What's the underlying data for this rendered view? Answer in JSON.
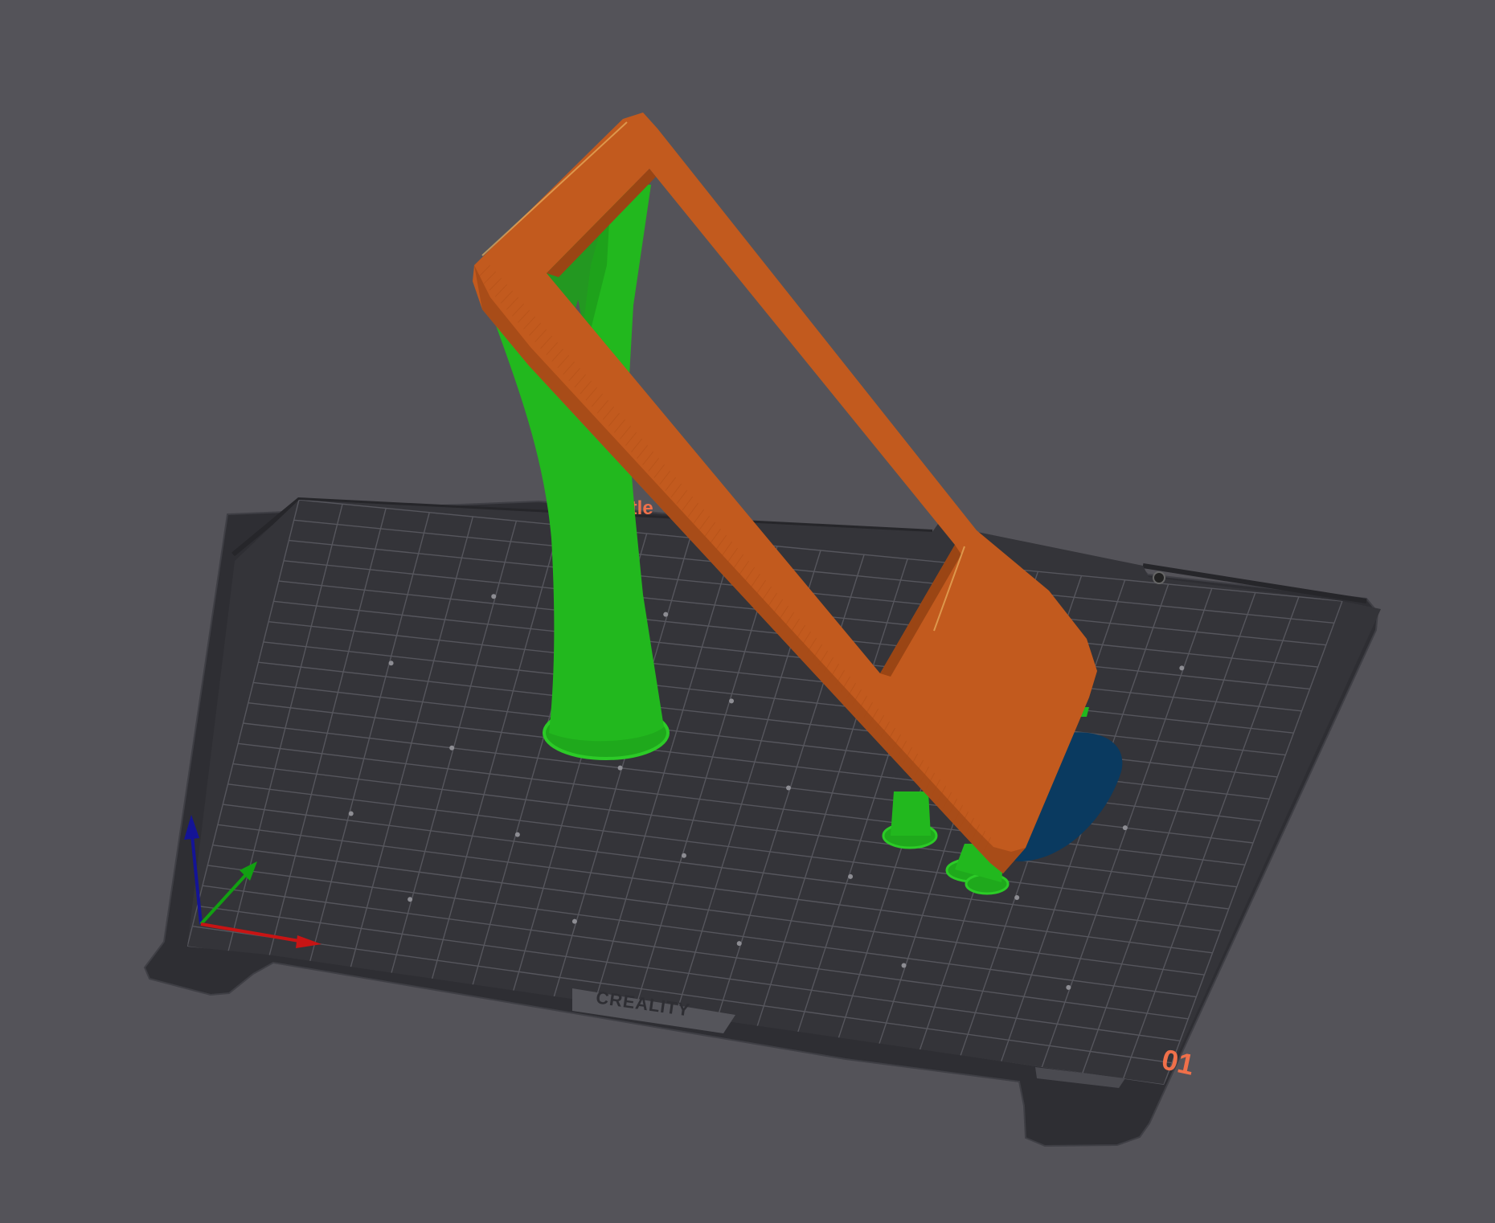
{
  "viewport": {
    "background_color": "#545359",
    "plate": {
      "brand_text": "CREALITY",
      "plate_number": "01",
      "plate_name_fragment": "itle",
      "surface_color": "#333338",
      "grid_color": "#55555c",
      "label_color": "#f0704a"
    },
    "model": {
      "part_color": "#c25a1e",
      "support_color": "#23bb1e",
      "overhang_highlight_color": "#0a3a60"
    },
    "axes": {
      "x_color": "#c81414",
      "y_color": "#12a012",
      "z_color": "#141496",
      "x_icon": "x-axis-arrow",
      "y_icon": "y-axis-arrow",
      "z_icon": "z-axis-arrow"
    }
  }
}
